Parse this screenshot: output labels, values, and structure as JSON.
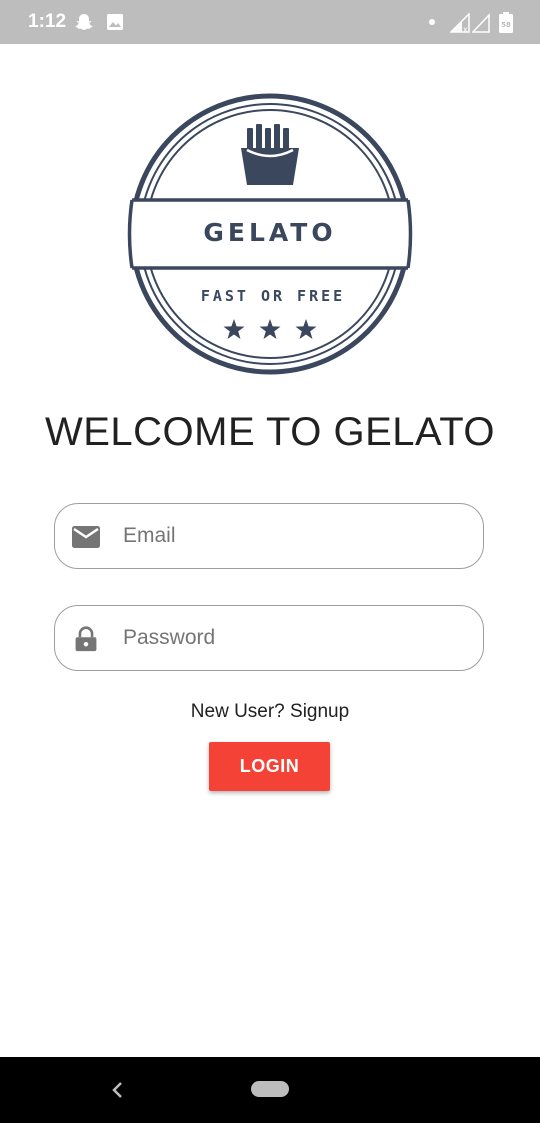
{
  "status_bar": {
    "time": "1:12",
    "icons": [
      "snapchat-icon",
      "image-icon",
      "dot-icon",
      "signal-icon",
      "signal-x-icon",
      "battery-icon"
    ]
  },
  "logo": {
    "title": "GELATO",
    "tagline": "FAST OR FREE",
    "icon": "fries-icon",
    "stars": 3,
    "color": "#3b475d"
  },
  "welcome_title": "WELCOME TO GELATO",
  "email": {
    "placeholder": "Email",
    "value": "",
    "icon": "email-icon"
  },
  "password": {
    "placeholder": "Password",
    "value": "",
    "icon": "lock-icon"
  },
  "signup_text": "New User? Signup",
  "login_button": {
    "label": "LOGIN",
    "color": "#f44336"
  },
  "nav_bar": {
    "icons": [
      "back-icon",
      "home-pill-icon"
    ]
  }
}
